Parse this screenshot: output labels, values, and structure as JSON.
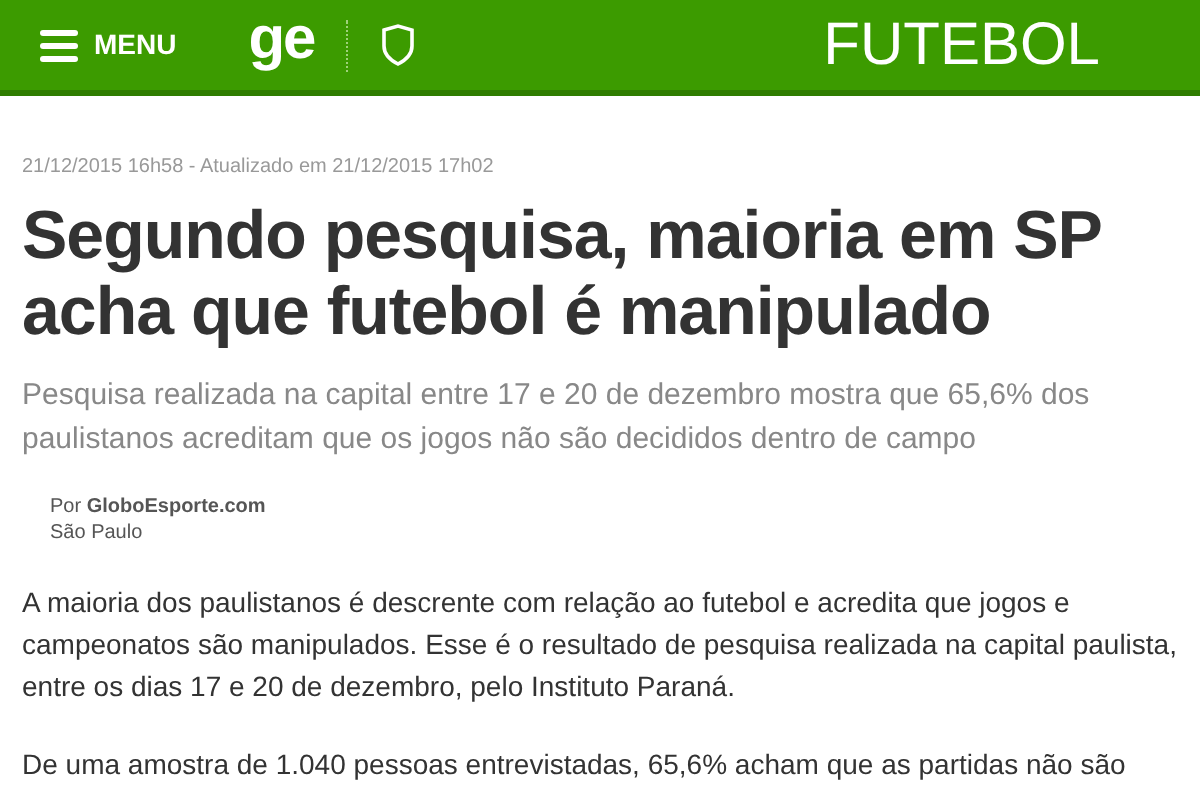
{
  "header": {
    "menu_label": "MENU",
    "logo": "ge",
    "section": "FUTEBOL"
  },
  "article": {
    "dateline": "21/12/2015 16h58 - Atualizado em 21/12/2015 17h02",
    "title": "Segundo pesquisa, maioria em SP acha que futebol é manipulado",
    "subtitle": "Pesquisa realizada na capital entre 17 e 20 de dezembro mostra que 65,6% dos paulistanos acreditam que os jogos não são decididos dentro de campo",
    "byline": "Por **GloboEsporte.com**",
    "location": "São Paulo",
    "paragraphs": [
      "A maioria dos paulistanos é descrente com relação ao futebol e acredita que jogos e campeonatos são manipulados. Esse é o resultado de pesquisa realizada na capital paulista, entre os dias 17 e 20 de dezembro, pelo Instituto Paraná.",
      "De uma amostra de 1.040 pessoas entrevistadas, 65,6% acham que as partidas não são"
    ]
  }
}
